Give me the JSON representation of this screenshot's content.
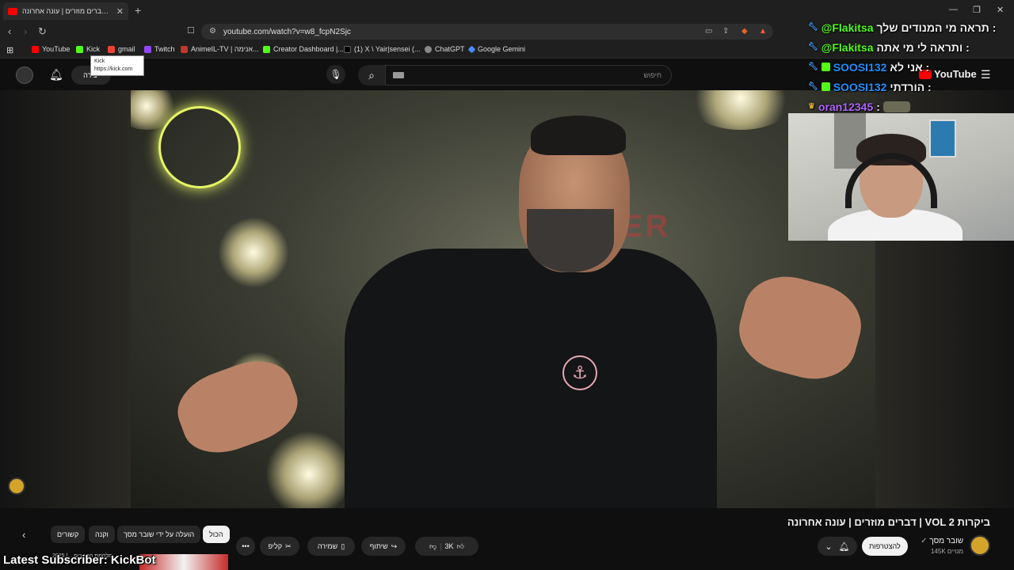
{
  "browser": {
    "tab_title": "דברים מוזרים | עונה אחרונה | VOL 2",
    "new_tab_label": "+",
    "url": "youtube.com/watch?v=w8_fcpN2Sjc",
    "bookmarks": [
      {
        "label": "YouTube",
        "color": "#ff0000"
      },
      {
        "label": "Kick",
        "color": "#53fc18"
      },
      {
        "label": "gmail",
        "color": "#ea4335"
      },
      {
        "label": "Twitch",
        "color": "#9146ff"
      },
      {
        "label": "AnimeIL-TV | אנימה...",
        "color": "#c0392b"
      },
      {
        "label": "Creator Dashboard |...",
        "color": "#53fc18"
      },
      {
        "label": "(1) X \\ Yair|sensei (...",
        "color": "#000000"
      },
      {
        "label": "ChatGPT",
        "color": "#888888"
      },
      {
        "label": "Google Gemini",
        "color": "#4a8cff"
      }
    ],
    "tooltip": {
      "title": "Kick",
      "url": "https://kick.com"
    }
  },
  "masthead": {
    "create_label": "יצירה",
    "search_placeholder": "חיפוש",
    "logo_text": "YouTube"
  },
  "chat": [
    {
      "user": "@Flakitsa",
      "user_color": "u-green",
      "message": "תראה מי המנודים שלך :"
    },
    {
      "user": "@Flakitsa",
      "user_color": "u-green",
      "message": "ותראה לי מי אתה :"
    },
    {
      "user": "SOOSI132",
      "user_color": "u-blue",
      "message": "אני לא :"
    },
    {
      "user": "SOOSI132",
      "user_color": "u-blue",
      "message": "הורדתי :"
    },
    {
      "user": "oran12345",
      "user_color": "u-purple",
      "message": ":"
    }
  ],
  "video": {
    "title": "דברים מוזרים | עונה אחרונה | VOL 2 ביקרות",
    "sign_text": "SER"
  },
  "channel": {
    "name": "שובר מסך",
    "subscribers": "145K מנויים",
    "subscribe_label": "להצטרפות"
  },
  "actions": {
    "like_count": "3K",
    "share_label": "שיתוף",
    "save_label": "שמירה",
    "clip_label": "קליפ",
    "more_label": "•••"
  },
  "chips": [
    {
      "label": "הכול",
      "active": true
    },
    {
      "label": "הועלה על ידי שובר מסך",
      "active": false
    },
    {
      "label": "וקנה",
      "active": false
    },
    {
      "label": "קשורים",
      "active": false
    }
  ],
  "overlay": {
    "ticker": "Latest Subscriber: KickBot",
    "thumb_caption": "2025 | ...מלחמת הכוכבים"
  }
}
